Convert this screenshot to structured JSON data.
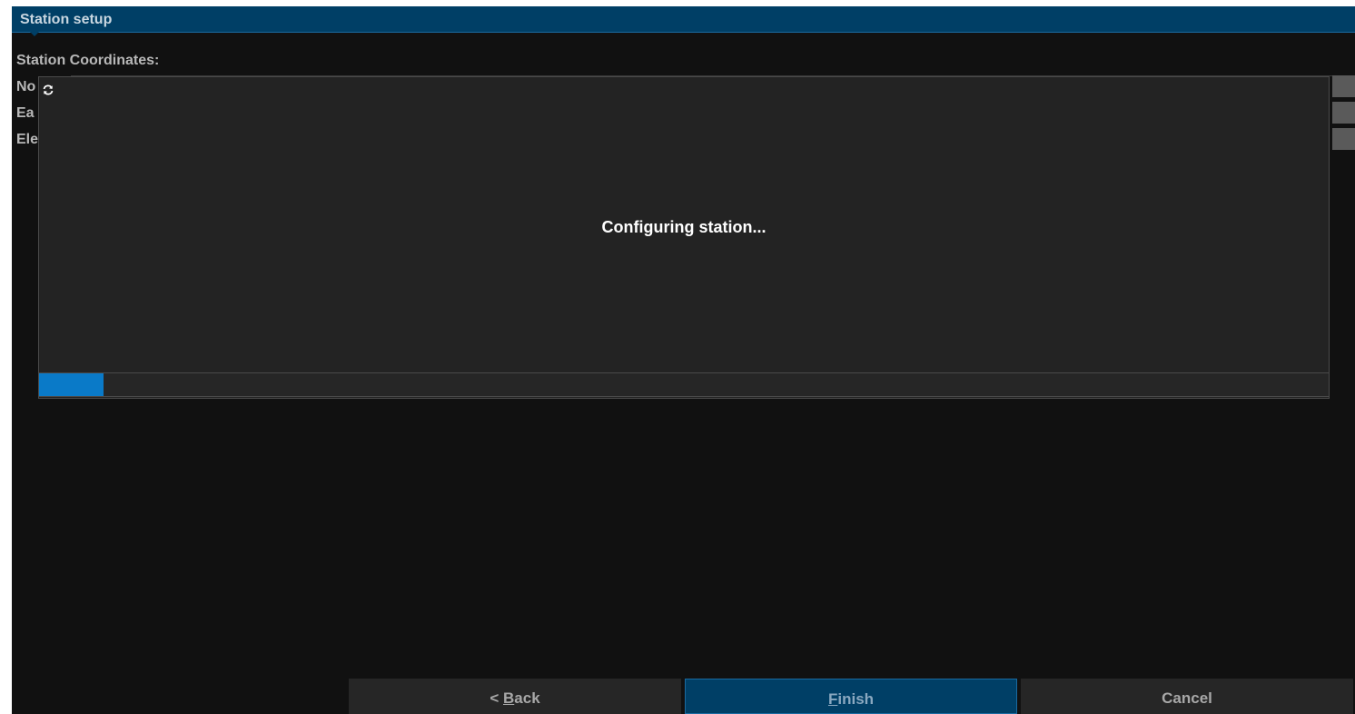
{
  "window": {
    "title": "Station setup"
  },
  "station": {
    "section_label": "Station Coordinates:",
    "fields": [
      {
        "label_visible": "No"
      },
      {
        "label_visible": "Ea"
      },
      {
        "label_visible": "Ele"
      }
    ]
  },
  "progress_dialog": {
    "icon": "sync-icon",
    "message": "Configuring station...",
    "progress_fraction": 0.05
  },
  "buttons": {
    "back": {
      "prefix": "< ",
      "mnemonic": "B",
      "rest": "ack"
    },
    "finish": {
      "prefix": "",
      "mnemonic": "F",
      "rest": "inish"
    },
    "cancel": {
      "label": "Cancel"
    }
  },
  "colors": {
    "titlebar": "#003f66",
    "accent": "#0a7ac8",
    "background": "#111111",
    "dialog": "#232323"
  }
}
